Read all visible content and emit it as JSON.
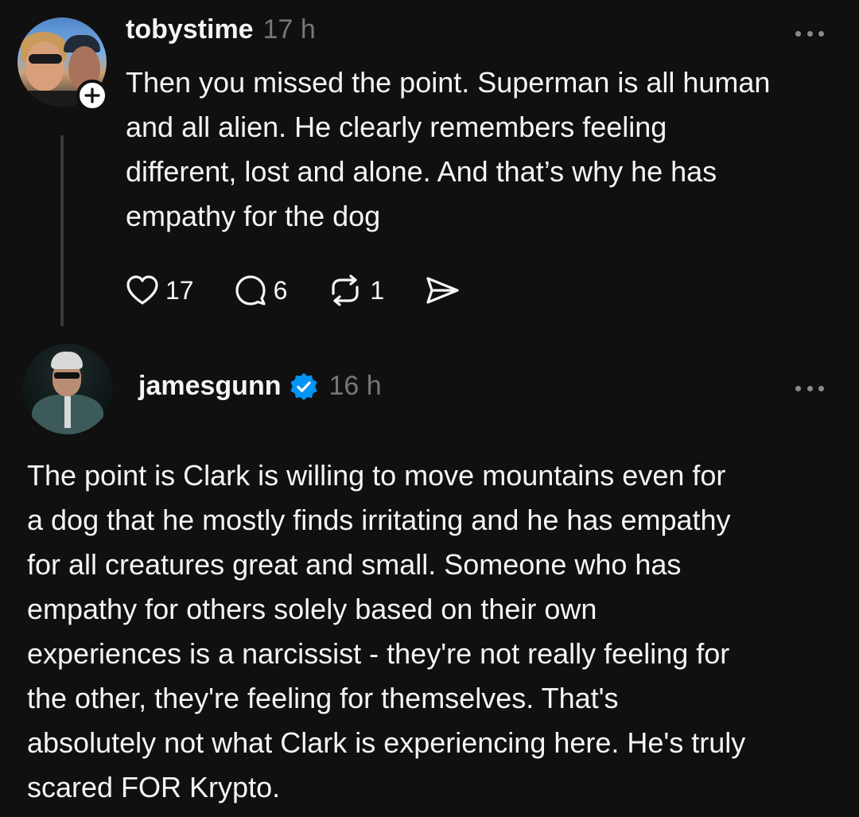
{
  "posts": [
    {
      "username": "tobystime",
      "timestamp": "17 h",
      "body": "Then you missed the point.  Superman is all human\nand all alien. He clearly remembers feeling\ndifferent, lost and alone.  And that’s why he has\nempathy for the dog",
      "actions": {
        "likes": "17",
        "replies": "6",
        "reposts": "1"
      },
      "icons": {
        "like": "heart-icon",
        "reply": "comment-icon",
        "repost": "repost-icon",
        "share": "send-icon",
        "follow": "plus-icon",
        "more": "more-icon"
      }
    },
    {
      "username": "jamesgunn",
      "timestamp": "16 h",
      "verified": true,
      "body": "The point is Clark is willing to move mountains even for\na dog that he mostly finds irritating and he has empathy\nfor all creatures great and small. Someone who has\nempathy for others solely based on their own\nexperiences is a narcissist - they're not really feeling for\nthe other, they're feeling for themselves. That's\nabsolutely not what Clark is experiencing here. He's truly\nscared FOR Krypto.",
      "icons": {
        "verified": "verified-badge-icon",
        "more": "more-icon"
      }
    }
  ],
  "colors": {
    "background": "#101010",
    "text": "#f3f5f7",
    "muted": "#777777",
    "verified": "#0095f6"
  }
}
